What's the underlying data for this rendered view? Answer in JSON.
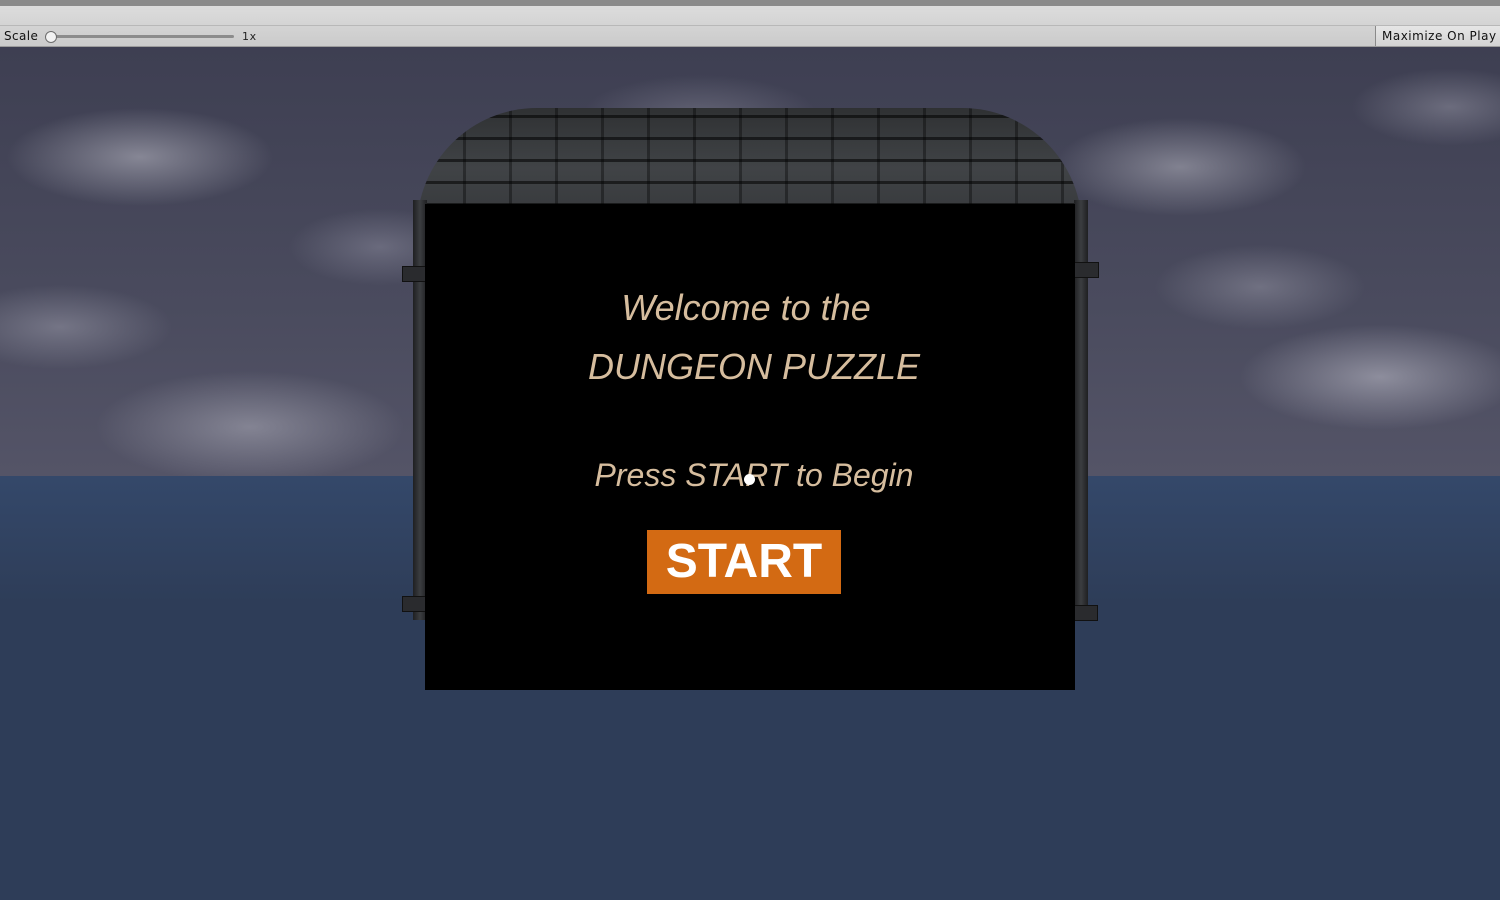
{
  "toolbar": {
    "scale_label": "Scale",
    "scale_value": "1x",
    "maximize_label": "Maximize On Play"
  },
  "menu": {
    "welcome_line": "Welcome to the",
    "game_title": "DUNGEON PUZZLE",
    "prompt": "Press START to Begin",
    "start_label": "START"
  },
  "colors": {
    "panel_background": "#000000",
    "title_text": "#d6bd9e",
    "start_button": "#d36a13",
    "ground": "#2e3d58"
  }
}
